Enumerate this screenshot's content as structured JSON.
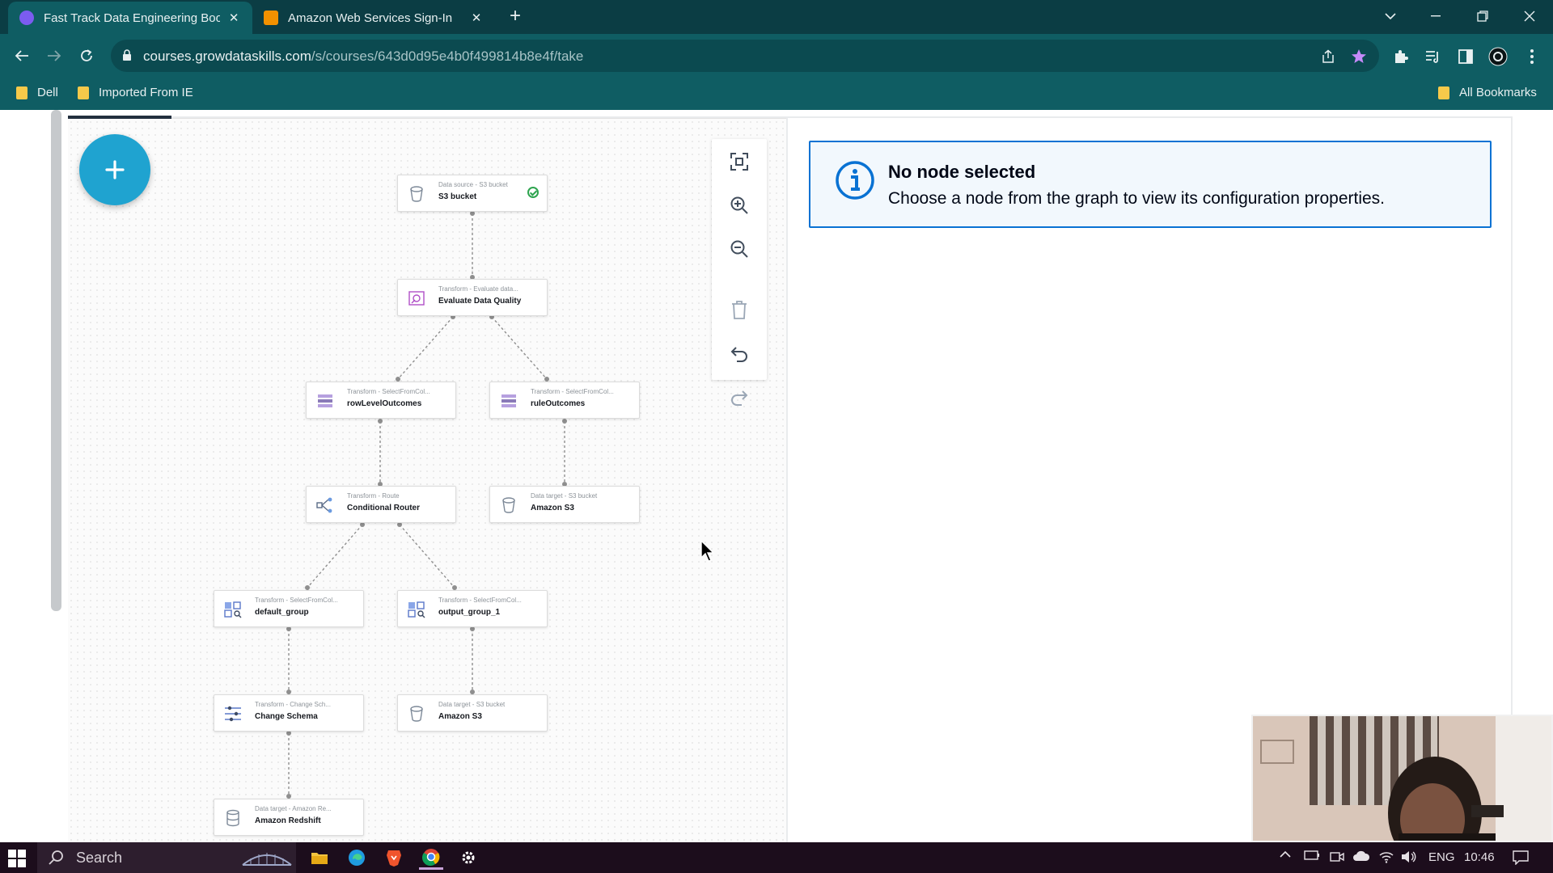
{
  "browser": {
    "tabs": [
      {
        "title": "Fast Track Data Engineering Boo",
        "close": "✕",
        "favicon_color": "#7b5cf0"
      },
      {
        "title": "Amazon Web Services Sign-In",
        "close": "✕",
        "favicon_color": "#f29100"
      }
    ],
    "new_tab": "+",
    "url_host": "courses.growdataskills.com",
    "url_path": "/s/courses/643d0d95e4b0f499814b8e4f/take",
    "bookmarks": [
      {
        "label": "Dell"
      },
      {
        "label": "Imported From IE"
      }
    ],
    "all_bookmarks": "All Bookmarks"
  },
  "canvas": {
    "add_button": "+",
    "nodes": [
      {
        "category": "Data source - S3 bucket",
        "name": "S3 bucket"
      },
      {
        "category": "Transform - Evaluate data...",
        "name": "Evaluate Data Quality"
      },
      {
        "category": "Transform - SelectFromCol...",
        "name": "rowLevelOutcomes"
      },
      {
        "category": "Transform - SelectFromCol...",
        "name": "ruleOutcomes"
      },
      {
        "category": "Transform - Route",
        "name": "Conditional Router"
      },
      {
        "category": "Data target - S3 bucket",
        "name": "Amazon S3"
      },
      {
        "category": "Transform - SelectFromCol...",
        "name": "default_group"
      },
      {
        "category": "Transform - SelectFromCol...",
        "name": "output_group_1"
      },
      {
        "category": "Transform - Change Sch...",
        "name": "Change Schema"
      },
      {
        "category": "Data target - S3 bucket",
        "name": "Amazon S3"
      },
      {
        "category": "Data target - Amazon Re...",
        "name": "Amazon Redshift"
      }
    ]
  },
  "info_panel": {
    "title": "No node selected",
    "body": "Choose a node from the graph to view its configuration properties."
  },
  "taskbar": {
    "search_label": "Search",
    "language": "ENG",
    "time": "10:46"
  },
  "colors": {
    "browser_dark": "#0b3d44",
    "browser_toolbar": "#0f5d63",
    "add_button": "#1fa3d0",
    "info_border": "#0972d3",
    "info_bg": "#f2f8fd",
    "taskbar": "#1c0d1c"
  }
}
